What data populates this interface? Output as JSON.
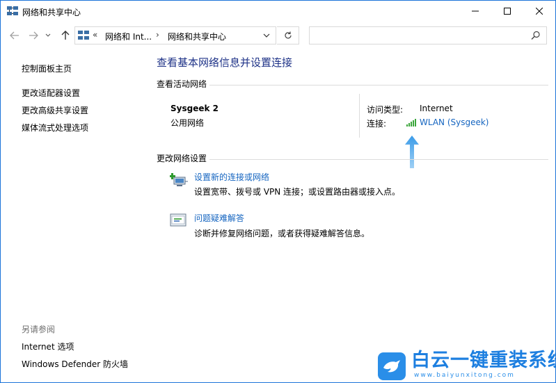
{
  "window": {
    "title": "网络和共享中心",
    "colors": {
      "accent": "#1a73d9",
      "link": "#1565c0",
      "heading": "#1e3287"
    }
  },
  "address_bar": {
    "overflow_chevron": "«",
    "segments": [
      "网络和 Int...",
      "网络和共享中心"
    ],
    "separator": "›",
    "search_placeholder": ""
  },
  "left_pane": {
    "home": "控制面板主页",
    "tasks": [
      "更改适配器设置",
      "更改高级共享设置",
      "媒体流式处理选项"
    ],
    "see_also_title": "另请参阅",
    "see_also": [
      "Internet 选项",
      "Windows Defender 防火墙"
    ]
  },
  "main": {
    "heading": "查看基本网络信息并设置连接",
    "active_networks_label": "查看活动网络",
    "network": {
      "name": "Sysgeek 2",
      "type": "公用网络",
      "access_type_key": "访问类型:",
      "access_type_value": "Internet",
      "connection_key": "连接:",
      "connection_value": "WLAN (Sysgeek)",
      "connection_icon": "wifi-signal-icon"
    },
    "change_settings_label": "更改网络设置",
    "actions": [
      {
        "title": "设置新的连接或网络",
        "desc": "设置宽带、拨号或 VPN 连接；或设置路由器或接入点。",
        "icon": "new-connection-icon"
      },
      {
        "title": "问题疑难解答",
        "desc": "诊断并修复网络问题，或者获得疑难解答信息。",
        "icon": "troubleshoot-icon"
      }
    ]
  },
  "watermark": {
    "title": "白云一键重装系统",
    "url": "www.baiyunxitong.com"
  }
}
